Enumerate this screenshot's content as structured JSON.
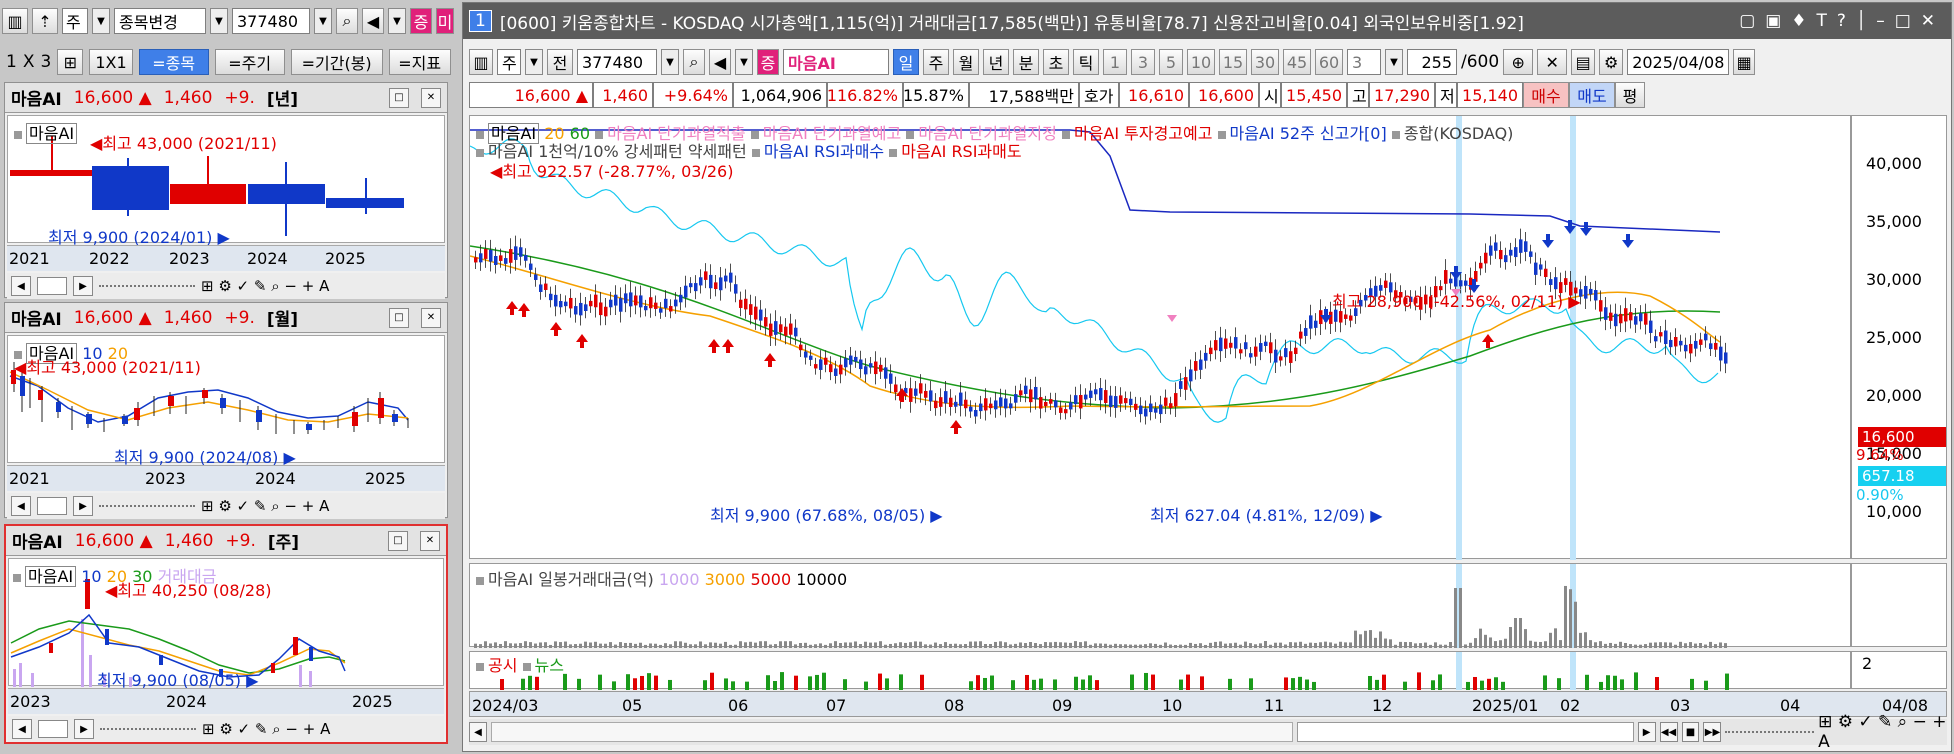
{
  "left_toolbar": {
    "type_label": "주",
    "search_label": "종목변경",
    "code": "377480",
    "tag": "증",
    "tag2": "미"
  },
  "left_controls": {
    "period_labels": [
      "1",
      "X",
      "3"
    ],
    "ratio_label": "1X1",
    "item_label": "=종목",
    "cycle_label": "=주기",
    "range_label": "=기간(봉)",
    "indicator_label": "=지표"
  },
  "panels": [
    {
      "name": "마음AI",
      "price": "16,600",
      "arrow": "▲",
      "change": "1,460",
      "pct": "+9.",
      "period": "[년]",
      "legend": "마음AI",
      "high": "최고 43,000 (2021/11)",
      "low": "최저 9,900 (2024/01)",
      "axis": [
        "2021",
        "2022",
        "2023",
        "2024",
        "2025"
      ]
    },
    {
      "name": "마음AI",
      "price": "16,600",
      "arrow": "▲",
      "change": "1,460",
      "pct": "+9.",
      "period": "[월]",
      "legend": "마음AI",
      "ma": [
        "10",
        "20"
      ],
      "high": "최고 43,000 (2021/11)",
      "low": "최저 9,900 (2024/08)",
      "axis": [
        "2021",
        "2023",
        "2024",
        "2025"
      ]
    },
    {
      "name": "마음AI",
      "price": "16,600",
      "arrow": "▲",
      "change": "1,460",
      "pct": "+9.",
      "period": "[주]",
      "legend": "마음AI",
      "ma": [
        "10",
        "20",
        "30"
      ],
      "extra": "거래대금",
      "high": "최고 40,250 (08/28)",
      "low": "최저 9,900 (08/05)",
      "axis": [
        "2023",
        "2024",
        "2025"
      ]
    }
  ],
  "window": {
    "num": "1",
    "title": "[0600] 키움종합차트 - KOSDAQ 시가총액[1,115(억)] 거래대금[17,585(백만)] 유통비율[78.7] 신용잔고비율[0.04] 외국인보유비중[1.92]"
  },
  "toolbar": {
    "type": "주",
    "jeon": "전",
    "code": "377480",
    "tag": "증",
    "stock": "마음AI",
    "periods": [
      "일",
      "주",
      "월",
      "년",
      "분",
      "초",
      "틱"
    ],
    "nums": [
      "1",
      "3",
      "5",
      "10",
      "15",
      "30",
      "45",
      "60"
    ],
    "sel": "3",
    "count": "255",
    "total": "/600",
    "date": "2025/04/08"
  },
  "quote": {
    "price": "16,600",
    "arrow": "▲",
    "change": "1,460",
    "pct": "+9.64%",
    "volume": "1,064,906",
    "vol_ratio": "116.82%",
    "turnover": "15.87%",
    "amount": "17,588백만",
    "hoga_label": "호가",
    "hoga1": "16,610",
    "hoga2": "16,600",
    "open_label": "시",
    "open": "15,450",
    "high_label": "고",
    "high": "17,290",
    "low_label": "저",
    "low": "15,140",
    "buy": "매수",
    "sell": "매도",
    "flat": "평"
  },
  "legend1": {
    "stock": "마음AI",
    "ma1": "20",
    "ma2": "60",
    "items": [
      "마음AI 단기과열적출",
      "마음AI 단기과열예고",
      "마음AI 단기과열지정",
      "마음AI 투자경고예고",
      "마음AI 52주 신고가[0]",
      "종합(KOSDAQ)"
    ]
  },
  "legend2": {
    "items": [
      "마음AI 1천억/10% 강세패턴",
      "약세패턴",
      "마음AI RSI과매수",
      "마음AI RSI과매도"
    ]
  },
  "main_chart": {
    "y_ticks": [
      "40,000",
      "35,000",
      "30,000",
      "25,000",
      "20,000",
      "15,000",
      "10,000"
    ],
    "price_tag": "16,600",
    "pct_tag": "9.64%",
    "index_tag": "657.18",
    "index_pct": "0.90%",
    "ann_high_index": "최고 922.57 (-28.77%, 03/26)",
    "ann_high": "최고 28,900 (-42.56%, 02/11)",
    "ann_low": "최저 9,900 (67.68%, 08/05)",
    "ann_low_index": "최저 627.04 (4.81%, 12/09)"
  },
  "volume": {
    "label": "마음AI 일봉거래대금(억)",
    "l1": "1000",
    "l2": "3000",
    "l3": "5000",
    "l4": "10000"
  },
  "news": {
    "l1": "공시",
    "l2": "뉴스",
    "tick": "2"
  },
  "x_axis": [
    "2024/03",
    "05",
    "06",
    "07",
    "08",
    "09",
    "10",
    "11",
    "12",
    "2025/01",
    "02",
    "03",
    "04",
    "04/08"
  ],
  "colors": {
    "up": "#e00000",
    "down": "#1038c8",
    "ma20": "#f5a000",
    "ma60": "#1a9a1a",
    "index": "#16c8f0",
    "blue_high": "#1a28c0"
  }
}
